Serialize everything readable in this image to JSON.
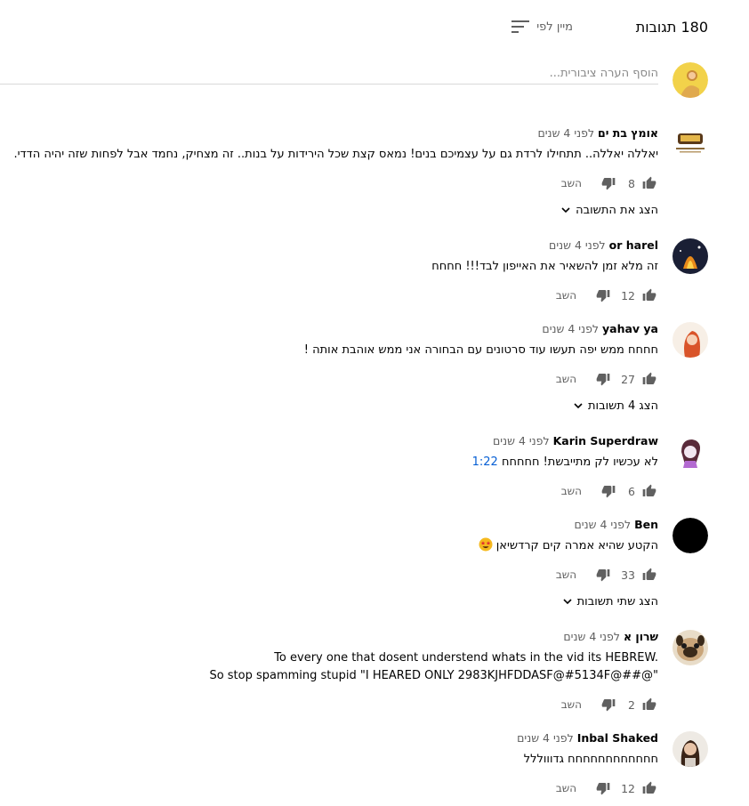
{
  "header": {
    "count_label": "180 תגובות",
    "sort_label": "מיין לפי",
    "sort_icon": "sort-icon"
  },
  "add_comment": {
    "placeholder": "הוסף הערה ציבורית..."
  },
  "actions": {
    "reply_label": "השב",
    "like_icon": "thumb-up-icon",
    "dislike_icon": "thumb-down-icon"
  },
  "comments": [
    {
      "author": "אומץ בת ים",
      "time": "לפני 4 שנים",
      "text": "יאללה יאללה.. תתחילו לרדת גם על עצמיכם בנים! נמאס קצת שכל הירידות על בנות.. זה מצחיק, נחמד אבל לפחות שזה יהיה הדדי.",
      "likes": "8",
      "replies_label": "הצג את התשובה"
    },
    {
      "author": "or harel",
      "time": "לפני 4 שנים",
      "text": "זה מלא זמן להשאיר את האייפון לבד!!! חחחח",
      "likes": "12"
    },
    {
      "author": "yahav ya",
      "time": "לפני 4 שנים",
      "text": "חחחח ממש יפה תעשו עוד סרטונים עם הבחורה אני ממש אוהבת אותה !",
      "likes": "27",
      "replies_label": "הצג 4 תשובות"
    },
    {
      "author": "Karin Superdraw",
      "time": "לפני 4 שנים",
      "text": "לא עכשיו לק מתייבשת! חחחחח",
      "timestamp": "1:22",
      "likes": "6"
    },
    {
      "author": "Ben",
      "time": "לפני 4 שנים",
      "text": "הקטע שהיא אמרה קים קרדשיאן",
      "emoji": "star-struck-emoji",
      "likes": "33",
      "replies_label": "הצג שתי תשובות"
    },
    {
      "author": "שרון א",
      "time": "לפני 4 שנים",
      "text_lines": [
        "To every one that dosent understend whats in the vid its HEBREW.",
        "So stop spamming stupid \"I HEARED ONLY 2983KJHFDDASF@#5134F@##@\""
      ],
      "likes": "2"
    },
    {
      "author": "Inbal Shaked",
      "time": "לפני 4 שנים",
      "text": "חחחחחחחחחחחח גדוווללל",
      "likes": "12"
    }
  ]
}
